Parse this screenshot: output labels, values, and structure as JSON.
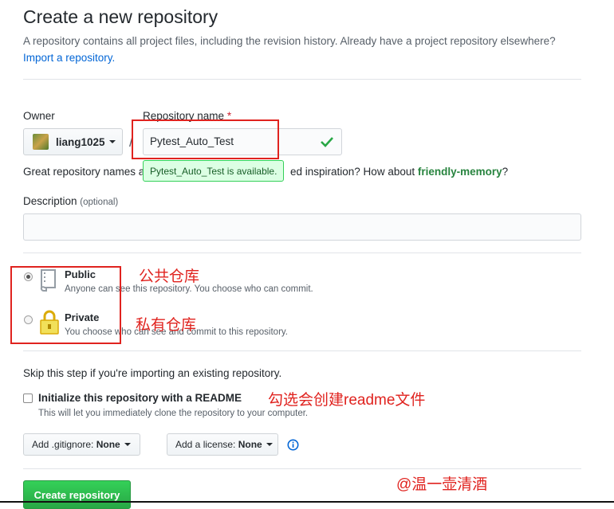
{
  "header": {
    "title": "Create a new repository",
    "subtitle": "A repository contains all project files, including the revision history. Already have a project repository elsewhere?",
    "import_link": "Import a repository."
  },
  "owner": {
    "label": "Owner",
    "value": "liang1025"
  },
  "repo": {
    "label": "Repository name",
    "required": "*",
    "value": "Pytest_Auto_Test",
    "available_tooltip": "Pytest_Auto_Test is available."
  },
  "hint": {
    "prefix": "Great repository names a",
    "suffix": "ed inspiration? How about",
    "suggestion": "friendly-memory",
    "end": "?"
  },
  "description": {
    "label": "Description",
    "optional": "(optional)",
    "value": ""
  },
  "visibility": {
    "public": {
      "label": "Public",
      "desc": "Anyone can see this repository. You choose who can commit.",
      "selected": true
    },
    "private": {
      "label": "Private",
      "desc": "You choose who can see and commit to this repository.",
      "selected": false
    }
  },
  "init": {
    "skip_text": "Skip this step if you're importing an existing repository.",
    "readme_label": "Initialize this repository with a README",
    "readme_desc": "This will let you immediately clone the repository to your computer.",
    "readme_checked": false
  },
  "gitignore": {
    "label": "Add .gitignore:",
    "value": "None"
  },
  "license": {
    "label": "Add a license:",
    "value": "None"
  },
  "create_button": "Create repository",
  "annotations": {
    "public": "公共仓库",
    "private": "私有仓库",
    "readme": "勾选会创建readme文件",
    "watermark": "@温一壶清酒"
  },
  "colors": {
    "link": "#0366d6",
    "success": "#28a745",
    "annotation_red": "#e0231f",
    "tooltip_bg": "#dcffe4"
  }
}
